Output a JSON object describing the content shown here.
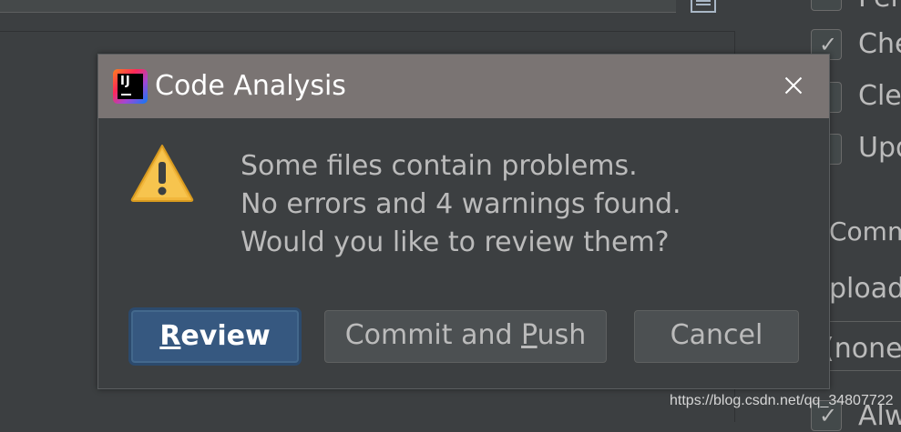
{
  "dialog": {
    "title": "Code Analysis",
    "app_icon_text": "IJ",
    "message_lines": [
      "Some files contain problems.",
      "No errors and 4 warnings found.",
      "Would you like to review them?"
    ],
    "buttons": {
      "review": {
        "mnemonic": "R",
        "rest": "eview"
      },
      "commit_push": {
        "before": "Commit and ",
        "mnemonic": "P",
        "rest": "ush"
      },
      "cancel": "Cancel"
    }
  },
  "background": {
    "right_panel": {
      "row1": "Per",
      "row2": "Che",
      "row3": "Cle",
      "row4": "Upd",
      "section": "Comm",
      "field_label": "pload",
      "field_value": "(none",
      "row_last": "Alw"
    }
  },
  "watermark": "https://blog.csdn.net/qq_34807722",
  "colors": {
    "titlebar": "#7a7473",
    "review_button": "#365880",
    "warning": "#f2b73c"
  }
}
